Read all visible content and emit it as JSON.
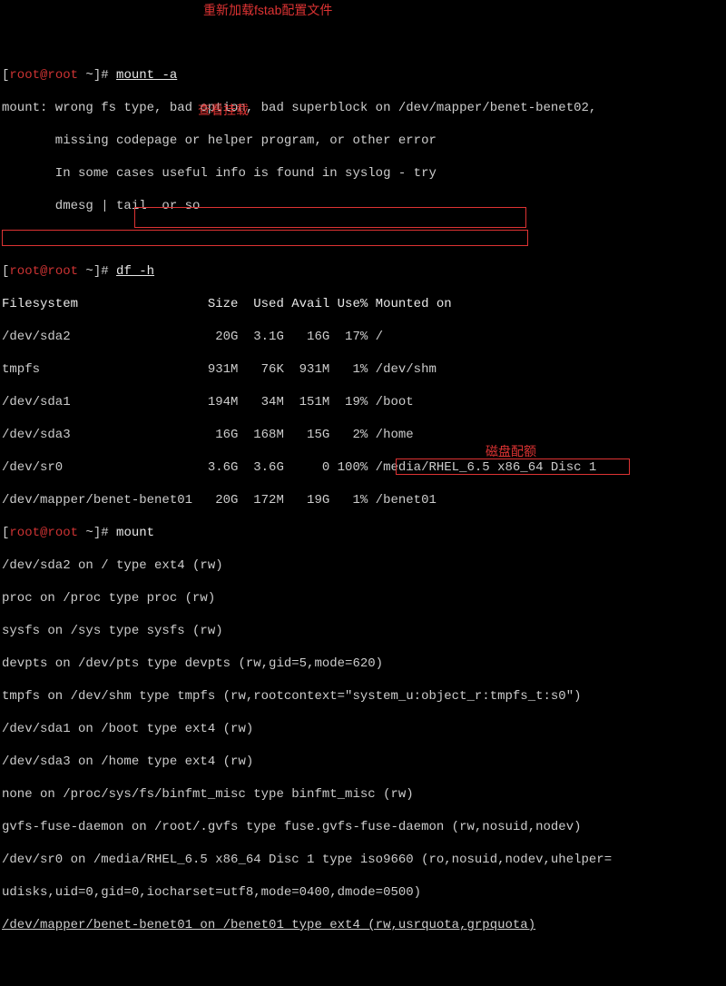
{
  "prompt": {
    "open": "[",
    "host": "root@root",
    "close": " ~]#",
    "sep": " "
  },
  "cmd1": "mount -a",
  "annot1": "重新加载fstab配置文件",
  "out1": {
    "l1": "mount: wrong fs type, bad option, bad superblock on /dev/mapper/benet-benet02,",
    "l2": "       missing codepage or helper program, or other error",
    "l3": "       In some cases useful info is found in syslog - try",
    "l4": "       dmesg | tail  or so"
  },
  "cmd2": "df -h",
  "annot2": "查看挂载",
  "df": {
    "header": "Filesystem                 Size  Used Avail Use% Mounted on",
    "r1": "/dev/sda2                   20G  3.1G   16G  17% /",
    "r2": "tmpfs                      931M   76K  931M   1% /dev/shm",
    "r3": "/dev/sda1                  194M   34M  151M  19% /boot",
    "r4": "/dev/sda3                   16G  168M   15G   2% /home",
    "r5": "/dev/sr0                   3.6G  3.6G     0 100% /media/RHEL_6.5 x86_64 Disc 1",
    "r6": "/dev/mapper/benet-benet01   20G  172M   19G   1% /benet01"
  },
  "cmd3": "mount",
  "mnt": {
    "l1": "/dev/sda2 on / type ext4 (rw)",
    "l2": "proc on /proc type proc (rw)",
    "l3": "sysfs on /sys type sysfs (rw)",
    "l4": "devpts on /dev/pts type devpts (rw,gid=5,mode=620)",
    "l5": "tmpfs on /dev/shm type tmpfs (rw,rootcontext=\"system_u:object_r:tmpfs_t:s0\")",
    "l6": "/dev/sda1 on /boot type ext4 (rw)",
    "l7": "/dev/sda3 on /home type ext4 (rw)",
    "l8": "none on /proc/sys/fs/binfmt_misc type binfmt_misc (rw)",
    "l9": "gvfs-fuse-daemon on /root/.gvfs type fuse.gvfs-fuse-daemon (rw,nosuid,nodev)",
    "l10": "/dev/sr0 on /media/RHEL_6.5 x86_64 Disc 1 type iso9660 (ro,nosuid,nodev,uhelper=",
    "l11": "udisks,uid=0,gid=0,iocharset=utf8,mode=0400,dmode=0500)",
    "l12": "/dev/mapper/benet-benet01 on /benet01 type ext4 (rw,usrquota,grpquota)"
  },
  "annot3": "磁盘配额"
}
